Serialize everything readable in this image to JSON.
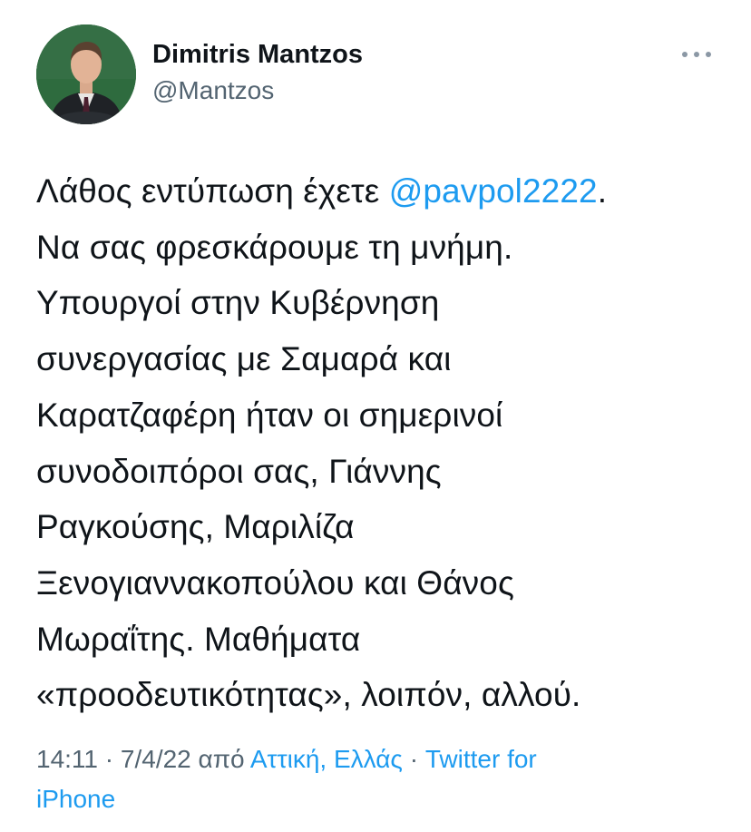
{
  "author": {
    "display_name": "Dimitris Mantzos",
    "handle": "@Mantzos"
  },
  "icons": {
    "more": "more-horizontal-icon",
    "avatar": "profile-photo"
  },
  "tweet": {
    "line1_text": "Λάθος εντύπωση έχετε ",
    "mention": "@pavpol2222",
    "line1_end": ".",
    "lines": [
      "Να σας φρεσκάρουμε τη μνήμη.",
      "Υπουργοί στην Κυβέρνηση",
      "συνεργασίας με Σαμαρά και",
      "Καρατζαφέρη ήταν οι σημερινοί",
      "συνοδοιπόροι σας, Γιάννης",
      "Ραγκούσης, Μαριλίζα",
      "Ξενογιαννακοπούλου και Θάνος",
      "Μωραΐτης. Μαθήματα",
      "«προοδευτικότητας», λοιπόν, αλλού."
    ]
  },
  "meta": {
    "time": "14:11",
    "sep1": " · ",
    "date": "7/4/22",
    "from": " από ",
    "location": "Αττική, Ελλάς",
    "sep2": " · ",
    "source_part1": "Twitter for",
    "source_part2": "iPhone"
  },
  "colors": {
    "link": "#1d9bf0",
    "secondary_text": "#536471",
    "primary_text": "#0f1419",
    "more_icon": "#8b98a5"
  }
}
